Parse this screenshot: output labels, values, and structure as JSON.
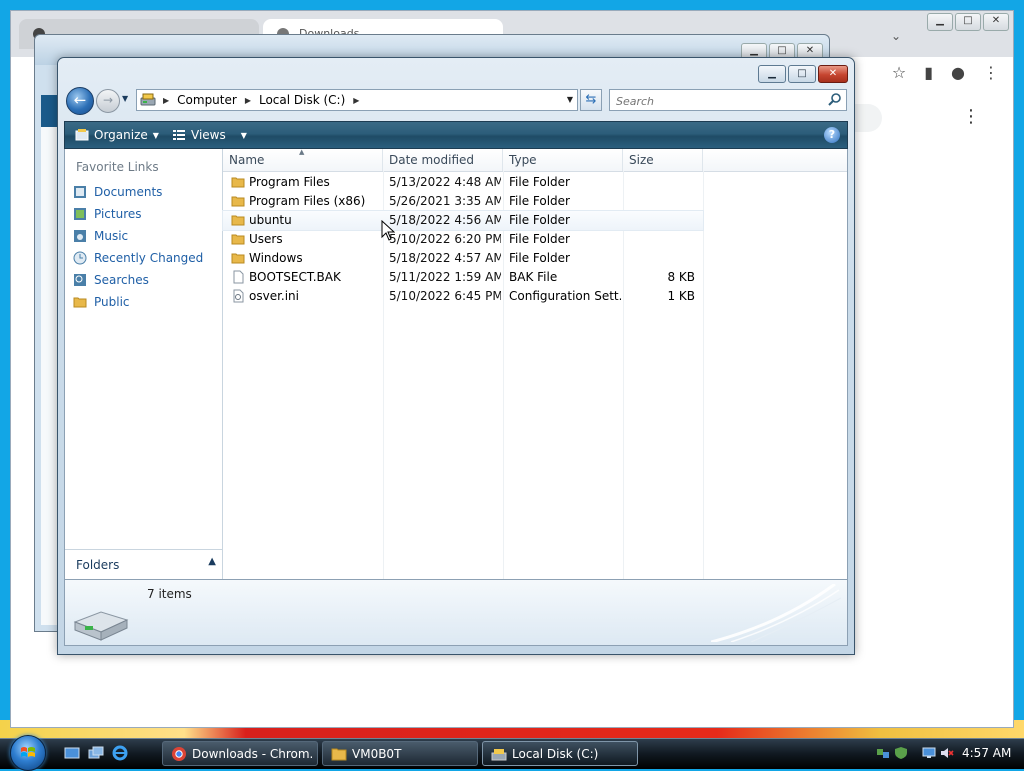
{
  "browser": {
    "tab_downloads": "Downloads",
    "menu_icon": "kebab-icon"
  },
  "window": {
    "minimize": "▁",
    "maximize": "□",
    "close": "✕"
  },
  "nav": {
    "breadcrumbs": [
      "Computer",
      "Local Disk (C:)"
    ],
    "search_placeholder": "Search"
  },
  "command_bar": {
    "organize": "Organize",
    "views": "Views",
    "help": "?"
  },
  "favorite_links": {
    "heading": "Favorite Links",
    "items": [
      "Documents",
      "Pictures",
      "Music",
      "Recently Changed",
      "Searches",
      "Public"
    ]
  },
  "folders_label": "Folders",
  "columns": [
    "Name",
    "Date modified",
    "Type",
    "Size"
  ],
  "files": [
    {
      "name": "Program Files",
      "date": "5/13/2022 4:48 AM",
      "type": "File Folder",
      "size": ""
    },
    {
      "name": "Program Files (x86)",
      "date": "5/26/2021 3:35 AM",
      "type": "File Folder",
      "size": ""
    },
    {
      "name": "ubuntu",
      "date": "5/18/2022 4:56 AM",
      "type": "File Folder",
      "size": ""
    },
    {
      "name": "Users",
      "date": "5/10/2022 6:20 PM",
      "type": "File Folder",
      "size": ""
    },
    {
      "name": "Windows",
      "date": "5/18/2022 4:57 AM",
      "type": "File Folder",
      "size": ""
    },
    {
      "name": "BOOTSECT.BAK",
      "date": "5/11/2022 1:59 AM",
      "type": "BAK File",
      "size": "8 KB"
    },
    {
      "name": "osver.ini",
      "date": "5/10/2022 6:45 PM",
      "type": "Configuration Sett...",
      "size": "1 KB"
    }
  ],
  "details": {
    "item_count": "7 items"
  },
  "taskbar": {
    "buttons": [
      "Downloads - Chrom...",
      "VM0B0T",
      "Local Disk (C:)"
    ],
    "clock": "4:57 AM"
  },
  "colors": {
    "desktop": "#12a6e6",
    "command_bar": "#2c5d7a",
    "link": "#1f5fa6",
    "folder": "#e8b84a"
  }
}
